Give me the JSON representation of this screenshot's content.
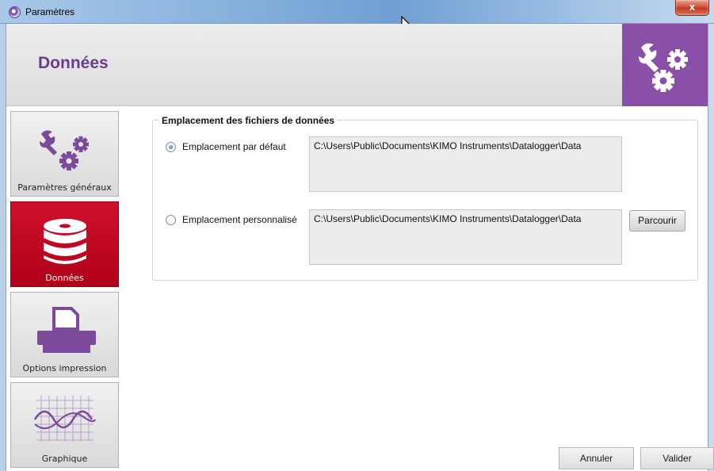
{
  "window": {
    "title": "Paramètres",
    "close_glyph": "x"
  },
  "header": {
    "title": "Données",
    "icon": "wrench-gears-icon"
  },
  "nav": {
    "items": [
      {
        "label": "Paramètres généraux",
        "icon": "wrench-gears-icon",
        "active": false
      },
      {
        "label": "Données",
        "icon": "database-icon",
        "active": true
      },
      {
        "label": "Options impression",
        "icon": "printer-icon",
        "active": false
      },
      {
        "label": "Graphique",
        "icon": "graph-icon",
        "active": false
      }
    ]
  },
  "location": {
    "legend": "Emplacement des fichiers de données",
    "default_option": {
      "label": "Emplacement par défaut",
      "selected": true,
      "path": "C:\\Users\\Public\\Documents\\KIMO Instruments\\Datalogger\\Data"
    },
    "custom_option": {
      "label": "Emplacement personnalisé",
      "selected": false,
      "path": "C:\\Users\\Public\\Documents\\KIMO Instruments\\Datalogger\\Data",
      "browse_label": "Parcourir"
    }
  },
  "footer": {
    "cancel_label": "Annuler",
    "ok_label": "Valider"
  },
  "colors": {
    "accent_purple": "#8a4fa6",
    "title_purple": "#6b3d8c",
    "active_red": "#c00822"
  }
}
